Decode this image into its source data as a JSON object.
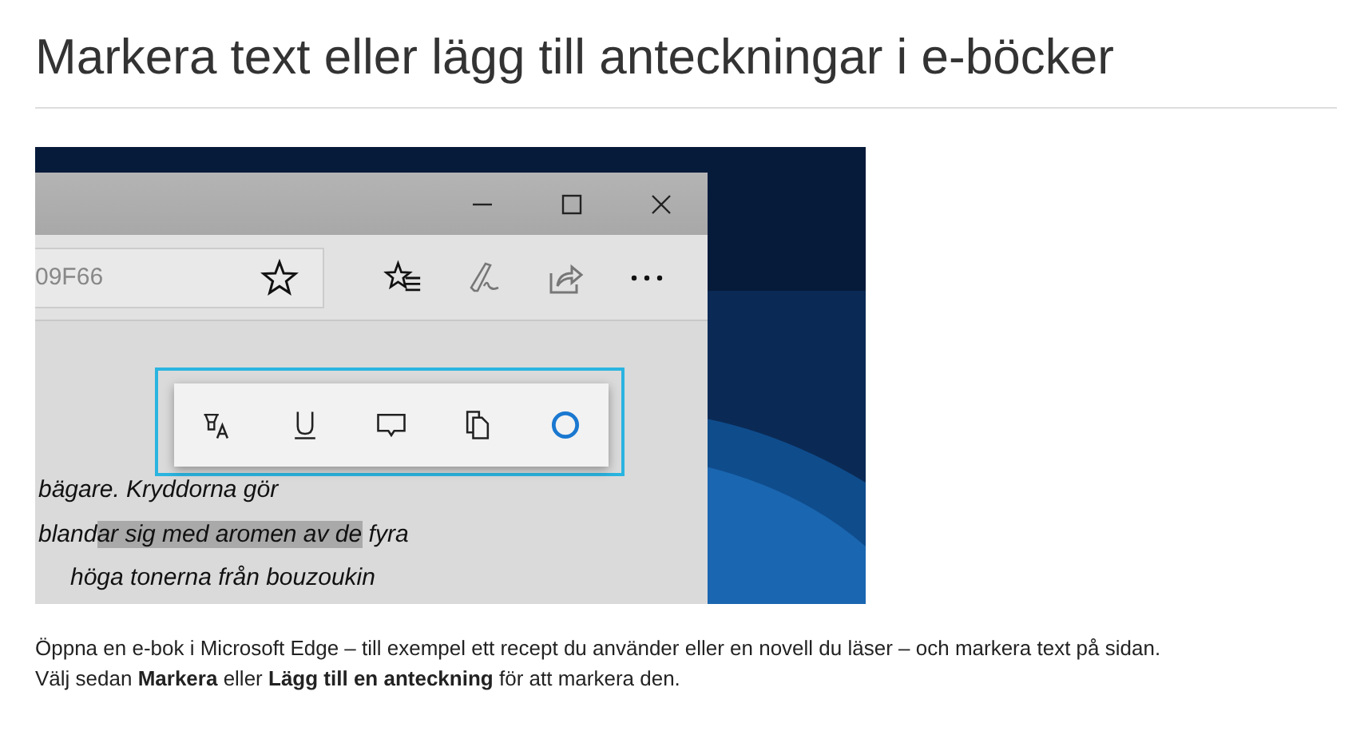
{
  "title": "Markera text eller lägg till anteckningar i e-böcker",
  "screenshot": {
    "address": "09F66",
    "lines": [
      {
        "parts": [
          {
            "text": "bägare. Kryddorna gör",
            "highlighted": false
          }
        ]
      },
      {
        "parts": [
          {
            "text": "bland",
            "highlighted": false
          },
          {
            "text": "ar sig med aromen av de",
            "highlighted": true
          },
          {
            "text": " fyra",
            "highlighted": false
          }
        ]
      },
      {
        "parts": [
          {
            "text": "höga tonerna från bouzoukin",
            "highlighted": false
          }
        ]
      }
    ]
  },
  "paragraph": [
    "Öppna en e-bok i Microsoft Edge – till exempel ett recept du använder eller en novell du läser – och markera text på sidan.",
    "Välj sedan **Markera** eller **Lägg till en anteckning** för att markera den."
  ]
}
